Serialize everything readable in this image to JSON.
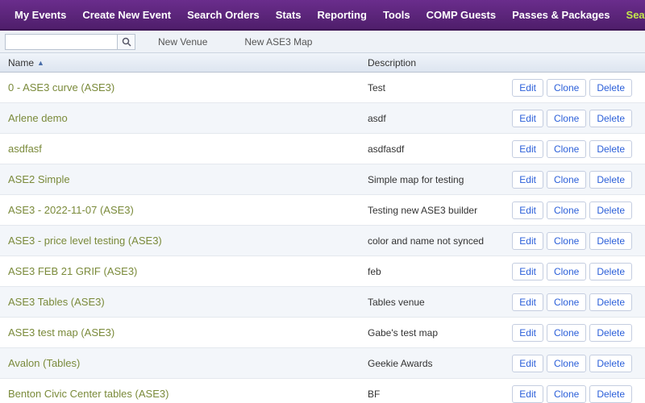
{
  "nav": {
    "items": [
      {
        "label": "My Events",
        "active": false
      },
      {
        "label": "Create New Event",
        "active": false
      },
      {
        "label": "Search Orders",
        "active": false
      },
      {
        "label": "Stats",
        "active": false
      },
      {
        "label": "Reporting",
        "active": false
      },
      {
        "label": "Tools",
        "active": false
      },
      {
        "label": "COMP Guests",
        "active": false
      },
      {
        "label": "Passes & Packages",
        "active": false
      },
      {
        "label": "Seating Maps",
        "active": true
      }
    ]
  },
  "toolbar": {
    "search_value": "",
    "new_venue": "New Venue",
    "new_map": "New ASE3 Map"
  },
  "grid": {
    "headers": {
      "name": "Name",
      "description": "Description"
    },
    "action_labels": {
      "edit": "Edit",
      "clone": "Clone",
      "delete": "Delete"
    },
    "rows": [
      {
        "name": "0 - ASE3 curve (ASE3)",
        "description": "Test"
      },
      {
        "name": "Arlene demo",
        "description": "asdf"
      },
      {
        "name": "asdfasf",
        "description": "asdfasdf"
      },
      {
        "name": "ASE2 Simple",
        "description": "Simple map for testing"
      },
      {
        "name": "ASE3 - 2022-11-07 (ASE3)",
        "description": "Testing new ASE3 builder"
      },
      {
        "name": "ASE3 - price level testing (ASE3)",
        "description": "color and name not synced"
      },
      {
        "name": "ASE3 FEB 21 GRIF (ASE3)",
        "description": "feb"
      },
      {
        "name": "ASE3 Tables (ASE3)",
        "description": "Tables venue"
      },
      {
        "name": "ASE3 test map (ASE3)",
        "description": "Gabe's test map"
      },
      {
        "name": "Avalon (Tables)",
        "description": "Geekie Awards"
      },
      {
        "name": "Benton Civic Center tables (ASE3)",
        "description": "BF"
      }
    ]
  }
}
